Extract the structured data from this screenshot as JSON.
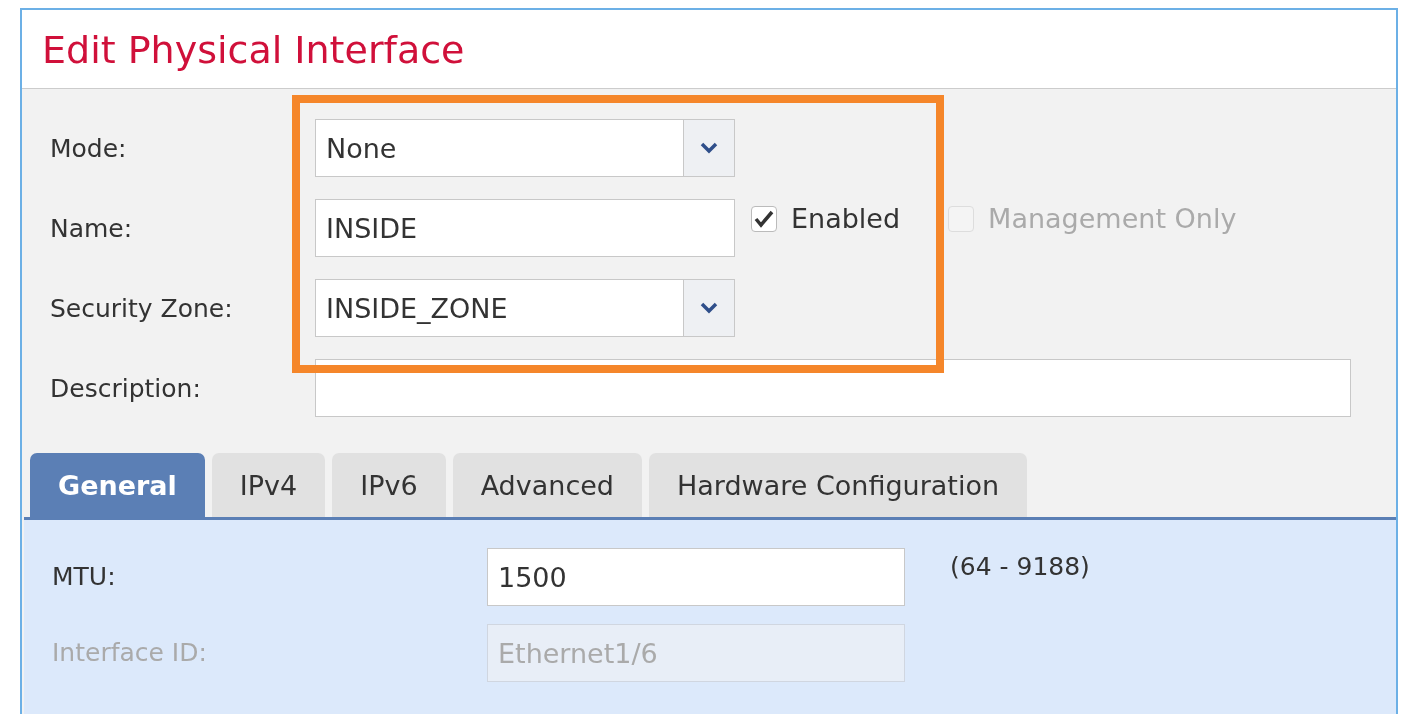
{
  "title": "Edit Physical Interface",
  "fields": [
    {
      "kind": "select",
      "label": "Mode:",
      "value": "None"
    },
    {
      "kind": "text",
      "label": "Name:",
      "value": "INSIDE"
    },
    {
      "kind": "select",
      "label": "Security Zone:",
      "value": "INSIDE_ZONE"
    },
    {
      "kind": "wide",
      "label": "Description:"
    }
  ],
  "checkboxes": [
    {
      "label": "Enabled",
      "checked": true,
      "disabled": false
    },
    {
      "label": "Management Only",
      "checked": false,
      "disabled": true
    }
  ],
  "tabs": [
    {
      "label": "General",
      "selected": true
    },
    {
      "label": "IPv4",
      "selected": false
    },
    {
      "label": "IPv6",
      "selected": false
    },
    {
      "label": "Advanced",
      "selected": false
    },
    {
      "label": "Hardware Configuration",
      "selected": false
    }
  ],
  "general": [
    {
      "label": "MTU:",
      "value": "1500",
      "hint": "(64 - 9188)",
      "disabled": false
    },
    {
      "label": "Interface ID:",
      "value": "Ethernet1/6",
      "disabled": true
    }
  ]
}
